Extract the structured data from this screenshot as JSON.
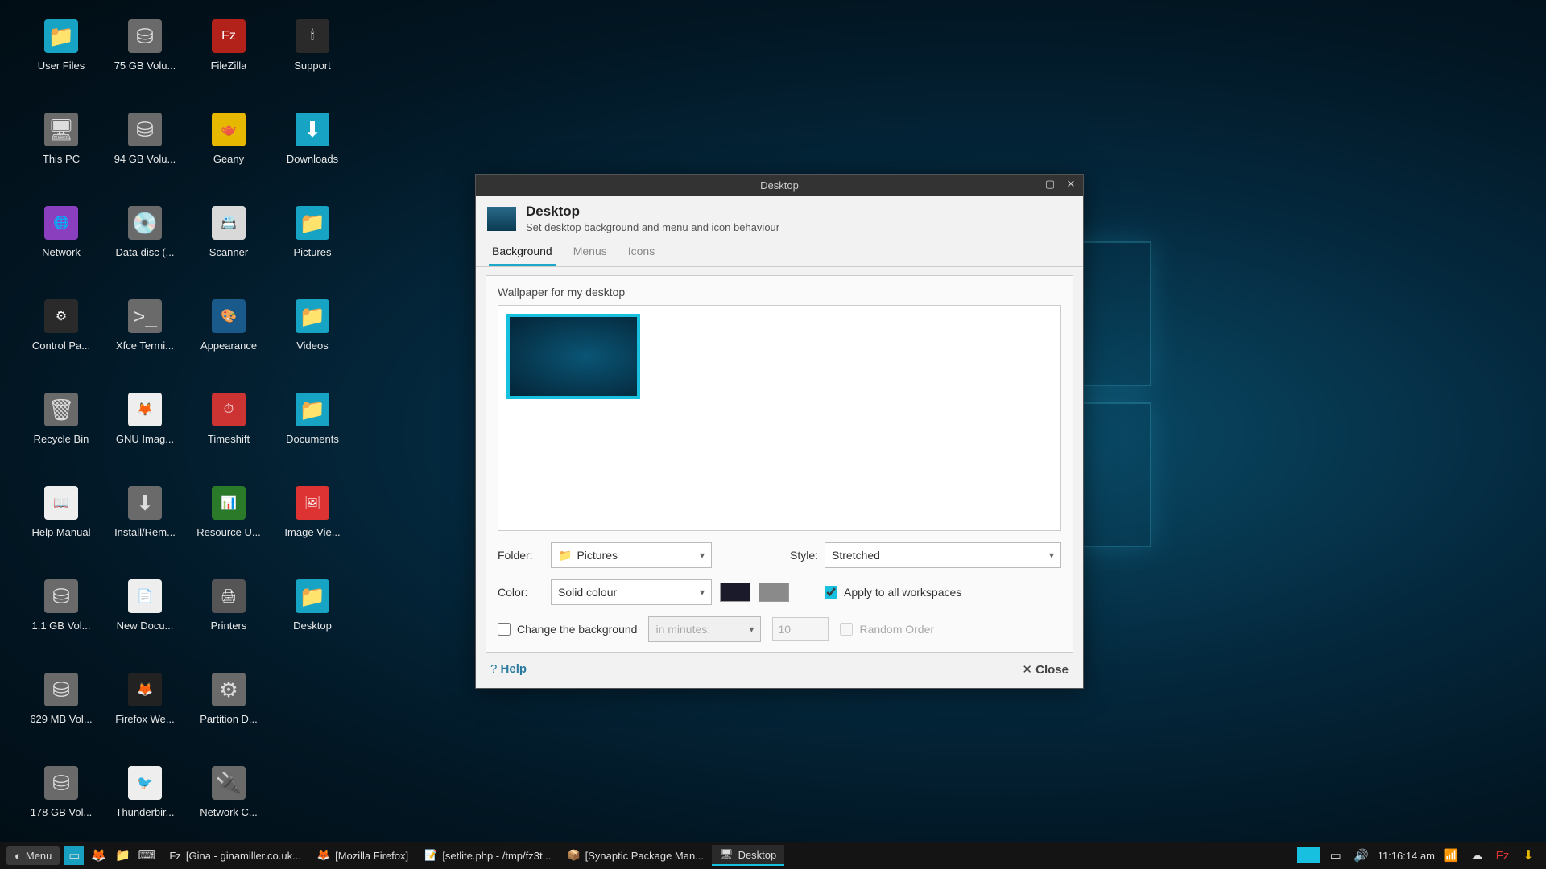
{
  "desktop": {
    "icons": [
      {
        "label": "User Files",
        "type": "folder"
      },
      {
        "label": "75 GB Volu...",
        "type": "drive"
      },
      {
        "label": "FileZilla",
        "type": "app",
        "bg": "#b3221a",
        "glyph": "Fz"
      },
      {
        "label": "Support",
        "type": "app",
        "bg": "#2a2a2a",
        "glyph": "🕯"
      },
      {
        "label": "This PC",
        "type": "drive",
        "glyph": "🖥"
      },
      {
        "label": "94 GB Volu...",
        "type": "drive"
      },
      {
        "label": "Geany",
        "type": "app",
        "bg": "#e6b800",
        "glyph": "🫖"
      },
      {
        "label": "Downloads",
        "type": "folder",
        "glyph": "⬇"
      },
      {
        "label": "Network",
        "type": "app",
        "bg": "#8a3fbf",
        "glyph": "🌐"
      },
      {
        "label": "Data disc (...",
        "type": "drive",
        "glyph": "💿"
      },
      {
        "label": "Scanner",
        "type": "app",
        "bg": "#d9d9d9",
        "glyph": "📇"
      },
      {
        "label": "Pictures",
        "type": "folder"
      },
      {
        "label": "Control Pa...",
        "type": "app",
        "bg": "#2a2a2a",
        "glyph": "⚙"
      },
      {
        "label": "Xfce Termi...",
        "type": "drive",
        "glyph": ">_"
      },
      {
        "label": "Appearance",
        "type": "app",
        "bg": "#1a5a8a",
        "glyph": "🎨"
      },
      {
        "label": "Videos",
        "type": "folder"
      },
      {
        "label": "Recycle Bin",
        "type": "drive",
        "glyph": "🗑"
      },
      {
        "label": "GNU Imag...",
        "type": "app",
        "bg": "#eee",
        "glyph": "🦊"
      },
      {
        "label": "Timeshift",
        "type": "app",
        "bg": "#c33",
        "glyph": "⏱"
      },
      {
        "label": "Documents",
        "type": "folder"
      },
      {
        "label": "Help Manual",
        "type": "app",
        "bg": "#eee",
        "glyph": "📖"
      },
      {
        "label": "Install/Rem...",
        "type": "drive",
        "glyph": "⬇"
      },
      {
        "label": "Resource U...",
        "type": "app",
        "bg": "#2a7a2a",
        "glyph": "📊"
      },
      {
        "label": "Image Vie...",
        "type": "app",
        "bg": "#d33",
        "glyph": "🖼"
      },
      {
        "label": "1.1 GB Vol...",
        "type": "drive"
      },
      {
        "label": "New Docu...",
        "type": "app",
        "bg": "#eee",
        "glyph": "📄"
      },
      {
        "label": "Printers",
        "type": "app",
        "bg": "#555",
        "glyph": "🖨"
      },
      {
        "label": "Desktop",
        "type": "folder"
      },
      {
        "label": "629 MB Vol...",
        "type": "drive"
      },
      {
        "label": "Firefox We...",
        "type": "app",
        "bg": "#222",
        "glyph": "🦊"
      },
      {
        "label": "Partition D...",
        "type": "drive",
        "glyph": "⚙"
      },
      {
        "label": "",
        "type": "blank"
      },
      {
        "label": "178 GB Vol...",
        "type": "drive"
      },
      {
        "label": "Thunderbir...",
        "type": "app",
        "bg": "#eee",
        "glyph": "🐦"
      },
      {
        "label": "Network C...",
        "type": "drive",
        "glyph": "🔌"
      }
    ]
  },
  "dialog": {
    "title": "Desktop",
    "heading": "Desktop",
    "subtitle": "Set desktop background and menu and icon behaviour",
    "tabs": [
      "Background",
      "Menus",
      "Icons"
    ],
    "active_tab": 0,
    "wallpaper_label": "Wallpaper for my desktop",
    "folder_label": "Folder:",
    "folder_value": "Pictures",
    "style_label": "Style:",
    "style_value": "Stretched",
    "color_label": "Color:",
    "color_value": "Solid colour",
    "apply_label": "Apply to all workspaces",
    "apply_checked": true,
    "change_label": "Change the background",
    "change_checked": false,
    "interval_unit": "in minutes:",
    "interval_value": "10",
    "random_label": "Random Order",
    "random_checked": false,
    "help_label": "Help",
    "close_label": "Close"
  },
  "taskbar": {
    "menu": "Menu",
    "tasks": [
      {
        "label": "[Gina - ginamiller.co.uk...",
        "icon": "Fz"
      },
      {
        "label": "[Mozilla Firefox]",
        "icon": "🦊"
      },
      {
        "label": "[setlite.php - /tmp/fz3t...",
        "icon": "📝"
      },
      {
        "label": "[Synaptic Package Man...",
        "icon": "📦"
      },
      {
        "label": "Desktop",
        "icon": "🖥",
        "active": true
      }
    ],
    "clock": "11:16:14 am"
  }
}
